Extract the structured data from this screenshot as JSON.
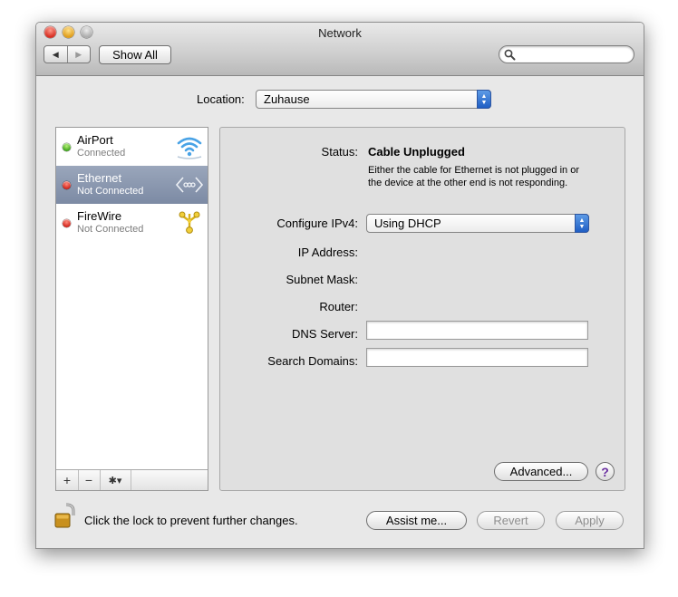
{
  "window": {
    "title": "Network"
  },
  "toolbar": {
    "back_icon": "◀",
    "forward_icon": "▶",
    "show_all_label": "Show All",
    "search_value": ""
  },
  "location": {
    "label": "Location:",
    "selected": "Zuhause"
  },
  "services": [
    {
      "name": "AirPort",
      "status": "Connected",
      "status_color": "green",
      "icon": "wifi-icon"
    },
    {
      "name": "Ethernet",
      "status": "Not Connected",
      "status_color": "red",
      "icon": "ethernet-icon",
      "selected": true
    },
    {
      "name": "FireWire",
      "status": "Not Connected",
      "status_color": "red",
      "icon": "firewire-icon"
    }
  ],
  "sidebar_toolbar": {
    "add": "+",
    "remove": "−",
    "action": "✱▾"
  },
  "detail": {
    "status_label": "Status:",
    "status_value": "Cable Unplugged",
    "status_description": "Either the cable for Ethernet is not plugged in or the device at the other end is not responding.",
    "configure_label": "Configure IPv4:",
    "configure_value": "Using DHCP",
    "ip_label": "IP Address:",
    "subnet_label": "Subnet Mask:",
    "router_label": "Router:",
    "dns_label": "DNS Server:",
    "dns_value": "",
    "search_domains_label": "Search Domains:",
    "search_domains_value": "",
    "advanced_label": "Advanced...",
    "help_label": "?"
  },
  "footer": {
    "lock_text": "Click the lock to prevent further changes.",
    "assist_label": "Assist me...",
    "revert_label": "Revert",
    "apply_label": "Apply"
  },
  "colors": {
    "selection": "#7c8aa4",
    "popup_accent": "#1f5ec4",
    "status_green": "#3da41a",
    "status_red": "#d1231a"
  }
}
